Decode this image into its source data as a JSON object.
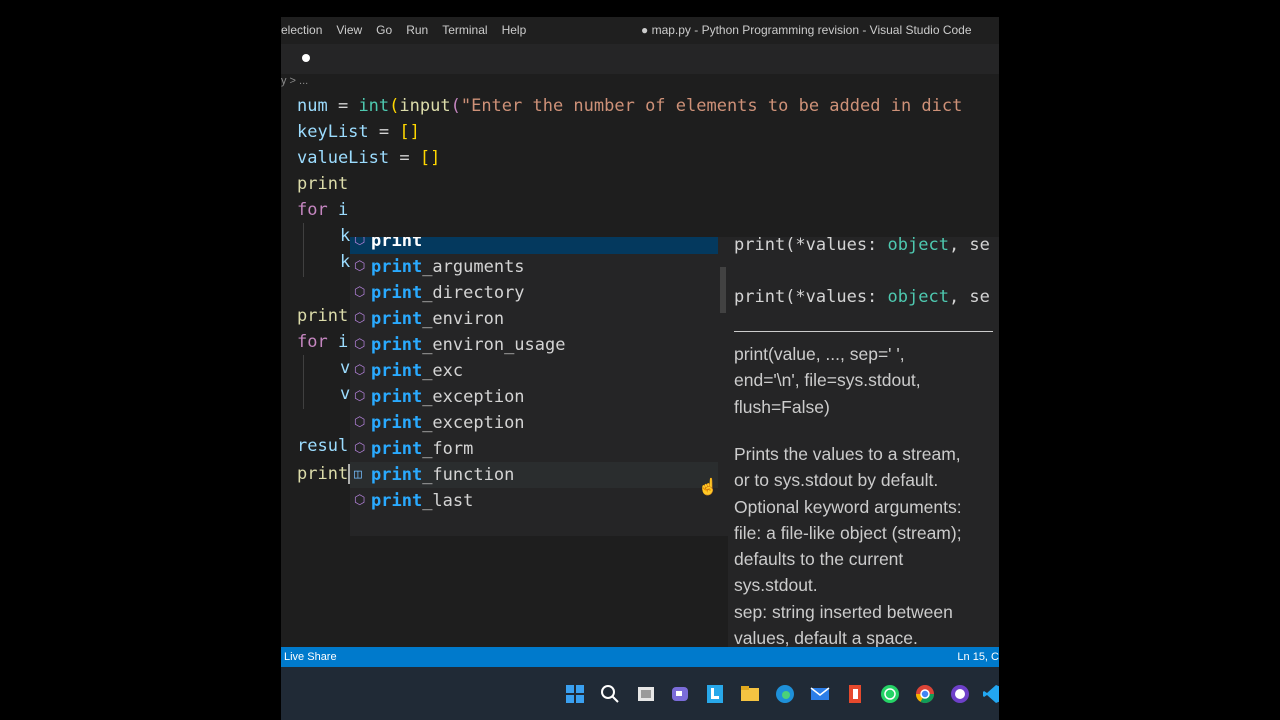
{
  "menubar": {
    "items": [
      "election",
      "View",
      "Go",
      "Run",
      "Terminal",
      "Help"
    ],
    "window_title": "● map.py - Python Programming revision - Visual Studio Code"
  },
  "breadcrumb": "y > ...",
  "code": {
    "line1_var": "num",
    "line1_eq": " = ",
    "line1_int": "int",
    "line1_input": "input",
    "line1_str": "\"Enter the number of elements to be added in dict",
    "line2_var": "keyList",
    "line2_rest": " = ",
    "line2_brackets": "[]",
    "line3_var": "valueList",
    "line3_rest": " = ",
    "line3_brackets": "[]",
    "line4": "print",
    "line5_kw": "for",
    "line5_rest": " i",
    "line6": "k",
    "line7": "k",
    "line8": "print",
    "line9_kw": "for",
    "line9_rest": " i",
    "line10": "v",
    "line11": "v",
    "line12": "resul",
    "line13": "print"
  },
  "suggestions": {
    "prefix": "print",
    "items": [
      {
        "match": "print",
        "rest": "",
        "icon": "cube-icon"
      },
      {
        "match": "print",
        "rest": "_arguments",
        "icon": "cube-icon"
      },
      {
        "match": "print",
        "rest": "_directory",
        "icon": "cube-icon"
      },
      {
        "match": "print",
        "rest": "_environ",
        "icon": "cube-icon"
      },
      {
        "match": "print",
        "rest": "_environ_usage",
        "icon": "cube-icon"
      },
      {
        "match": "print",
        "rest": "_exc",
        "icon": "cube-icon"
      },
      {
        "match": "print",
        "rest": "_exception",
        "icon": "cube-icon"
      },
      {
        "match": "print",
        "rest": "_exception",
        "icon": "cube-icon"
      },
      {
        "match": "print",
        "rest": "_form",
        "icon": "cube-icon"
      },
      {
        "match": "print",
        "rest": "_function",
        "icon": "variable-icon"
      },
      {
        "match": "print",
        "rest": "_last",
        "icon": "cube-icon"
      }
    ]
  },
  "details": {
    "sig1_prefix": "print(*values: ",
    "sig1_type": "object",
    "sig1_suffix": ", se",
    "sig2_prefix": "print(*values: ",
    "sig2_type": "object",
    "sig2_suffix": ", se",
    "signature_doc": "print(value, ..., sep=' ',\nend='\\n', file=sys.stdout,\nflush=False)",
    "description": "Prints the values to a stream,\nor to sys.stdout by default.\nOptional keyword arguments:\nfile: a file-like object (stream);\ndefaults to the current\nsys.stdout.\nsep: string inserted between\nvalues, default a space.\nend: string appended after\nthe last value, default a\nnewline."
  },
  "statusbar": {
    "left": "Live Share",
    "right": "Ln 15, C"
  },
  "taskbar": {
    "icons": [
      "windows-start-icon",
      "search-icon",
      "task-view-icon",
      "chat-icon",
      "notes-icon",
      "file-explorer-icon",
      "edge-icon",
      "mail-icon",
      "office-icon",
      "whatsapp-icon",
      "chrome-icon",
      "github-desktop-icon",
      "vscode-icon"
    ]
  }
}
